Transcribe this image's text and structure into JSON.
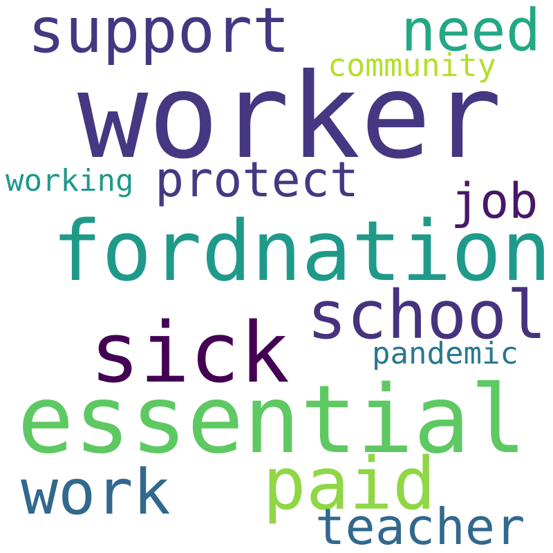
{
  "words": [
    {
      "id": "worker",
      "text": "worker",
      "color": "#453781"
    },
    {
      "id": "support",
      "text": "support",
      "color": "#453781"
    },
    {
      "id": "need",
      "text": "need",
      "color": "#22a884"
    },
    {
      "id": "community",
      "text": "community",
      "color": "#b5de2b"
    },
    {
      "id": "protect",
      "text": "protect",
      "color": "#443983"
    },
    {
      "id": "working",
      "text": "working",
      "color": "#1f998a"
    },
    {
      "id": "job",
      "text": "job",
      "color": "#481769"
    },
    {
      "id": "fordnation",
      "text": "fordnation",
      "color": "#1f9a8a"
    },
    {
      "id": "school",
      "text": "school",
      "color": "#46337e"
    },
    {
      "id": "sick",
      "text": "sick",
      "color": "#440154"
    },
    {
      "id": "pandemic",
      "text": "pandemic",
      "color": "#2a788e"
    },
    {
      "id": "essential",
      "text": "essential",
      "color": "#5ec962"
    },
    {
      "id": "paid",
      "text": "paid",
      "color": "#8fd744"
    },
    {
      "id": "work",
      "text": "work",
      "color": "#31688e"
    },
    {
      "id": "teacher",
      "text": "teacher",
      "color": "#31688e"
    }
  ]
}
